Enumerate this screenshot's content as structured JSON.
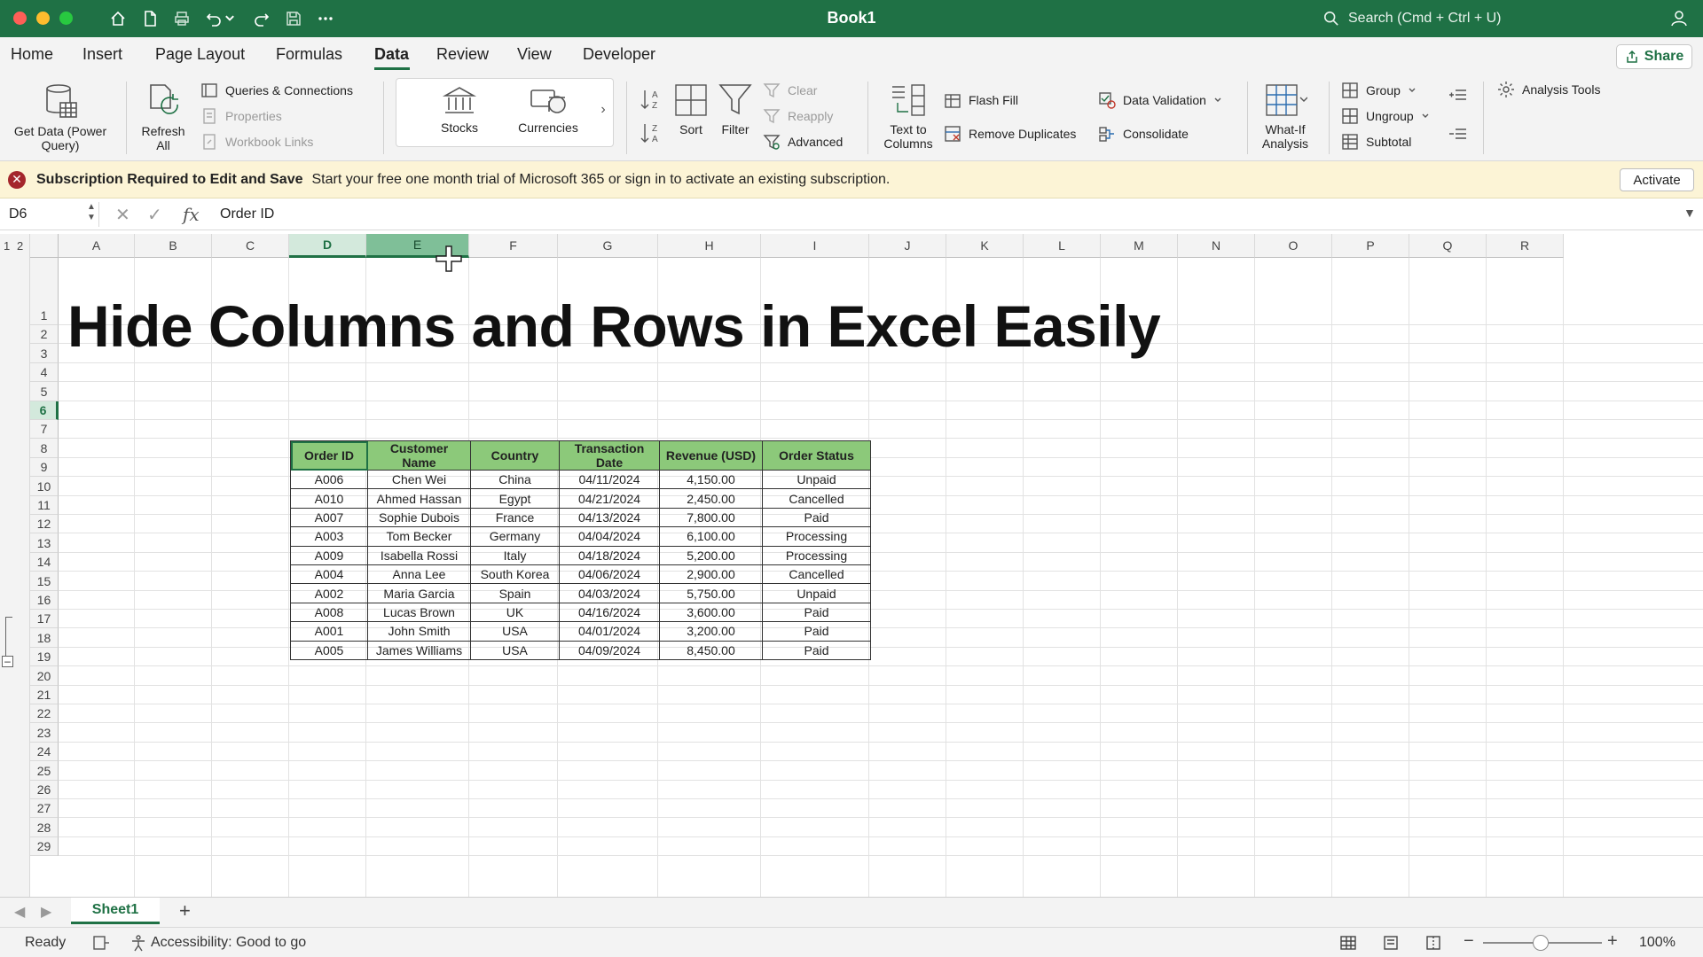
{
  "titlebar": {
    "title": "Book1",
    "search_placeholder": "Search (Cmd + Ctrl + U)",
    "colors": {
      "close": "#ff5f57",
      "minimize": "#febc2e",
      "zoom": "#28c840",
      "bar": "#1f7145"
    }
  },
  "tabs": [
    {
      "label": "Home"
    },
    {
      "label": "Insert"
    },
    {
      "label": "Page Layout"
    },
    {
      "label": "Formulas"
    },
    {
      "label": "Data"
    },
    {
      "label": "Review"
    },
    {
      "label": "View"
    },
    {
      "label": "Developer"
    }
  ],
  "active_tab": "Data",
  "share_label": "Share",
  "ribbon": {
    "get_data": "Get Data (Power Query)",
    "refresh_all": "Refresh All",
    "queries_connections": "Queries & Connections",
    "properties": "Properties",
    "workbook_links": "Workbook Links",
    "stocks": "Stocks",
    "currencies": "Currencies",
    "sort": "Sort",
    "filter": "Filter",
    "clear": "Clear",
    "reapply": "Reapply",
    "advanced": "Advanced",
    "text_to_columns": "Text to Columns",
    "flash_fill": "Flash Fill",
    "remove_duplicates": "Remove Duplicates",
    "data_validation": "Data Validation",
    "consolidate": "Consolidate",
    "what_if": "What-If Analysis",
    "group": "Group",
    "ungroup": "Ungroup",
    "subtotal": "Subtotal",
    "analysis_tools": "Analysis Tools"
  },
  "message_bar": {
    "title": "Subscription Required to Edit and Save",
    "text": "Start your free one month trial of Microsoft 365 or sign in to activate an existing subscription.",
    "button": "Activate"
  },
  "formula_bar": {
    "name_box": "D6",
    "value": "Order ID"
  },
  "outline_levels": [
    "1",
    "2"
  ],
  "columns": [
    "A",
    "B",
    "C",
    "D",
    "E",
    "F",
    "G",
    "H",
    "I",
    "J",
    "K",
    "L",
    "M",
    "N",
    "O",
    "P",
    "Q",
    "R"
  ],
  "rows": [
    "1",
    "2",
    "3",
    "4",
    "5",
    "6",
    "7",
    "8",
    "9",
    "10",
    "11",
    "12",
    "13",
    "14",
    "15",
    "16",
    "17",
    "18",
    "19",
    "20",
    "21",
    "22",
    "23",
    "24",
    "25",
    "26",
    "27",
    "28",
    "29"
  ],
  "sheet_title": "Hide Columns and Rows in Excel Easily",
  "table": {
    "headers": [
      "Order ID",
      "Customer Name",
      "Country",
      "Transaction Date",
      "Revenue (USD)",
      "Order Status"
    ],
    "rows": [
      [
        "A006",
        "Chen Wei",
        "China",
        "04/11/2024",
        "4,150.00",
        "Unpaid"
      ],
      [
        "A010",
        "Ahmed Hassan",
        "Egypt",
        "04/21/2024",
        "2,450.00",
        "Cancelled"
      ],
      [
        "A007",
        "Sophie Dubois",
        "France",
        "04/13/2024",
        "7,800.00",
        "Paid"
      ],
      [
        "A003",
        "Tom Becker",
        "Germany",
        "04/04/2024",
        "6,100.00",
        "Processing"
      ],
      [
        "A009",
        "Isabella Rossi",
        "Italy",
        "04/18/2024",
        "5,200.00",
        "Processing"
      ],
      [
        "A004",
        "Anna Lee",
        "South Korea",
        "04/06/2024",
        "2,900.00",
        "Cancelled"
      ],
      [
        "A002",
        "Maria Garcia",
        "Spain",
        "04/03/2024",
        "5,750.00",
        "Unpaid"
      ],
      [
        "A008",
        "Lucas Brown",
        "UK",
        "04/16/2024",
        "3,600.00",
        "Paid"
      ],
      [
        "A001",
        "John Smith",
        "USA",
        "04/01/2024",
        "3,200.00",
        "Paid"
      ],
      [
        "A005",
        "James Williams",
        "USA",
        "04/09/2024",
        "8,450.00",
        "Paid"
      ]
    ]
  },
  "sheet_tabs": {
    "active": "Sheet1",
    "add_label": "+"
  },
  "status": {
    "ready": "Ready",
    "accessibility": "Accessibility: Good to go",
    "zoom": "100%",
    "zoom_fraction": 0.5
  }
}
